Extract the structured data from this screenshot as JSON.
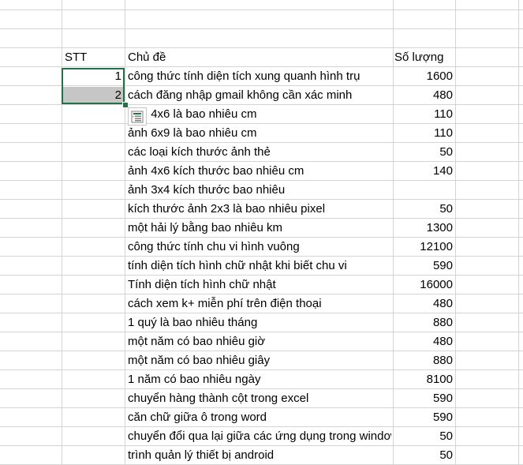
{
  "sheet": {
    "headers": {
      "stt": "STT",
      "topic": "Chủ đề",
      "count": "Số lượng"
    },
    "rows": [
      {
        "stt": "1",
        "topic": "công thức tính diện tích xung quanh hình trụ",
        "count": "1600"
      },
      {
        "stt": "2",
        "topic": "cách đăng nhập gmail không cần xác minh",
        "count": "480"
      },
      {
        "stt": "",
        "topic": "ảnh 4x6 là bao nhiêu cm",
        "count": "110"
      },
      {
        "stt": "",
        "topic": "ảnh 6x9 là bao nhiêu cm",
        "count": "110"
      },
      {
        "stt": "",
        "topic": "các loại kích thước ảnh thẻ",
        "count": "50"
      },
      {
        "stt": "",
        "topic": "ảnh 4x6 kích thước bao nhiêu cm",
        "count": "140"
      },
      {
        "stt": "",
        "topic": "ảnh 3x4 kích thước bao nhiêu",
        "count": ""
      },
      {
        "stt": "",
        "topic": "kích thước ảnh 2x3 là bao nhiêu pixel",
        "count": "50"
      },
      {
        "stt": "",
        "topic": "một hải lý bằng bao nhiêu km",
        "count": "1300"
      },
      {
        "stt": "",
        "topic": "công thức tính chu vi hình vuông",
        "count": "12100"
      },
      {
        "stt": "",
        "topic": "tính diện tích hình chữ nhật khi biết chu vi",
        "count": "590"
      },
      {
        "stt": "",
        "topic": "Tính diện tích hình chữ nhật",
        "count": "16000"
      },
      {
        "stt": "",
        "topic": "cách xem k+ miễn phí trên điện thoại",
        "count": "480"
      },
      {
        "stt": "",
        "topic": "1 quý là bao nhiêu tháng",
        "count": "880"
      },
      {
        "stt": "",
        "topic": "một năm có bao nhiêu giờ",
        "count": "480"
      },
      {
        "stt": "",
        "topic": "một năm có bao nhiêu giây",
        "count": "880"
      },
      {
        "stt": "",
        "topic": "1 năm có bao nhiêu ngày",
        "count": "8100"
      },
      {
        "stt": "",
        "topic": "chuyển hàng thành cột trong excel",
        "count": "590"
      },
      {
        "stt": "",
        "topic": "căn chữ giữa ô trong word",
        "count": "590"
      },
      {
        "stt": "",
        "topic": "chuyển đổi qua lại giữa các ứng dụng trong windows",
        "count": "50"
      },
      {
        "stt": "",
        "topic": "trình quản lý thiết bị android",
        "count": "50"
      }
    ]
  },
  "colors": {
    "selection_border": "#217346",
    "selection_fill": "#c6c6c6",
    "grid": "#d4d4d4"
  },
  "icons": {
    "autofill": "auto-fill-options-icon"
  }
}
